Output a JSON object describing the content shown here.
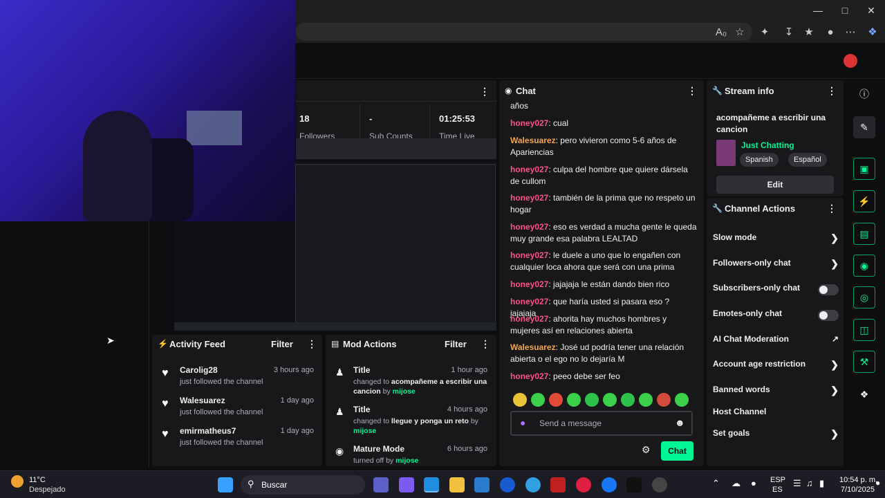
{
  "stats": {
    "followers_value": "18",
    "followers_label": "Followers",
    "subs_value": "-",
    "subs_label": "Sub Counts",
    "time_value": "01:25:53",
    "time_label": "Time Live"
  },
  "activity_feed": {
    "title": "Activity Feed",
    "filter": "Filter",
    "items": [
      {
        "name": "Carolig28",
        "text": "just followed the channel",
        "time": "3 hours ago"
      },
      {
        "name": "Walesuarez",
        "text": "just followed the channel",
        "time": "1 day ago"
      },
      {
        "name": "emirmatheus7",
        "text": "just followed the channel",
        "time": "1 day ago"
      }
    ]
  },
  "mod_actions": {
    "title": "Mod Actions",
    "filter": "Filter",
    "items": [
      {
        "title": "Title",
        "time": "1 hour ago",
        "prefix": "changed to ",
        "value": "acompañeme a escribir una cancion",
        "by_word": " by ",
        "by": "mijose"
      },
      {
        "title": "Title",
        "time": "4 hours ago",
        "prefix": "changed to ",
        "value": "llegue y ponga un reto",
        "by_word": " by ",
        "by": "mijose"
      },
      {
        "title": "Mature Mode",
        "time": "6 hours ago",
        "prefix": "turned off by ",
        "value": "",
        "by_word": "",
        "by": "mijose"
      }
    ]
  },
  "chat": {
    "title": "Chat",
    "messages": [
      {
        "user": "",
        "text": "años",
        "color": "pink"
      },
      {
        "user": "honey027",
        "text": ": cual",
        "color": "pink"
      },
      {
        "user": "Walesuarez",
        "text": ": pero vivieron como 5-6 años de Apariencias",
        "color": "orange"
      },
      {
        "user": "honey027",
        "text": ": culpa del hombre que quiere dársela de cullom",
        "color": "pink"
      },
      {
        "user": "honey027",
        "text": ": también de la prima que no respeto un hogar",
        "color": "pink"
      },
      {
        "user": "honey027",
        "text": ": eso es verdad a mucha gente le queda muy grande esa palabra LEALTAD",
        "color": "pink"
      },
      {
        "user": "honey027",
        "text": ": le duele a uno que lo engañen con cualquier loca ahora que será con una prima",
        "color": "pink"
      },
      {
        "user": "honey027",
        "text": ": jajajaja le están dando bien rico",
        "color": "pink"
      },
      {
        "user": "honey027",
        "text": ": que haría usted si pasara eso ? jajajaja",
        "color": "pink"
      },
      {
        "user": "honey027",
        "text": ": ahorita hay muchos hombres y mujeres así en relaciones abierta",
        "color": "pink"
      },
      {
        "user": "Walesuarez",
        "text": ": José ud podría tener una relación abierta o el ego no lo dejaría M",
        "color": "orange"
      },
      {
        "user": "honey027",
        "text": ": peeo debe ser feo",
        "color": "pink"
      }
    ],
    "placeholder": "Send a message",
    "send_label": "Chat"
  },
  "stream_info": {
    "title": "Stream info",
    "stream_title": "acompañeme a escribir una cancion",
    "category": "Just Chatting",
    "tags": [
      "Spanish",
      "Español"
    ],
    "edit_label": "Edit"
  },
  "channel_actions": {
    "title": "Channel Actions",
    "items": [
      {
        "label": "Slow mode",
        "control": "chevron"
      },
      {
        "label": "Followers-only chat",
        "control": "chevron"
      },
      {
        "label": "Subscribers-only chat",
        "control": "toggle"
      },
      {
        "label": "Emotes-only chat",
        "control": "toggle"
      },
      {
        "label": "AI Chat Moderation",
        "control": "external"
      },
      {
        "label": "Account age restriction",
        "control": "chevron"
      },
      {
        "label": "Banned words",
        "control": "chevron"
      },
      {
        "label": "Host Channel",
        "control": "none"
      },
      {
        "label": "Set goals",
        "control": "chevron"
      }
    ]
  },
  "taskbar": {
    "weather_temp": "11°C",
    "weather_desc": "Despejado",
    "search_label": "Buscar",
    "lang_top": "ESP",
    "lang_bottom": "ES",
    "time": "10:54 p. m.",
    "date": "7/10/2025"
  },
  "colors": {
    "accent": "#00f593",
    "bg": "#0e0e10",
    "panel": "#18181b",
    "user_pink": "#ff4f8b",
    "user_orange": "#f3a64a"
  }
}
